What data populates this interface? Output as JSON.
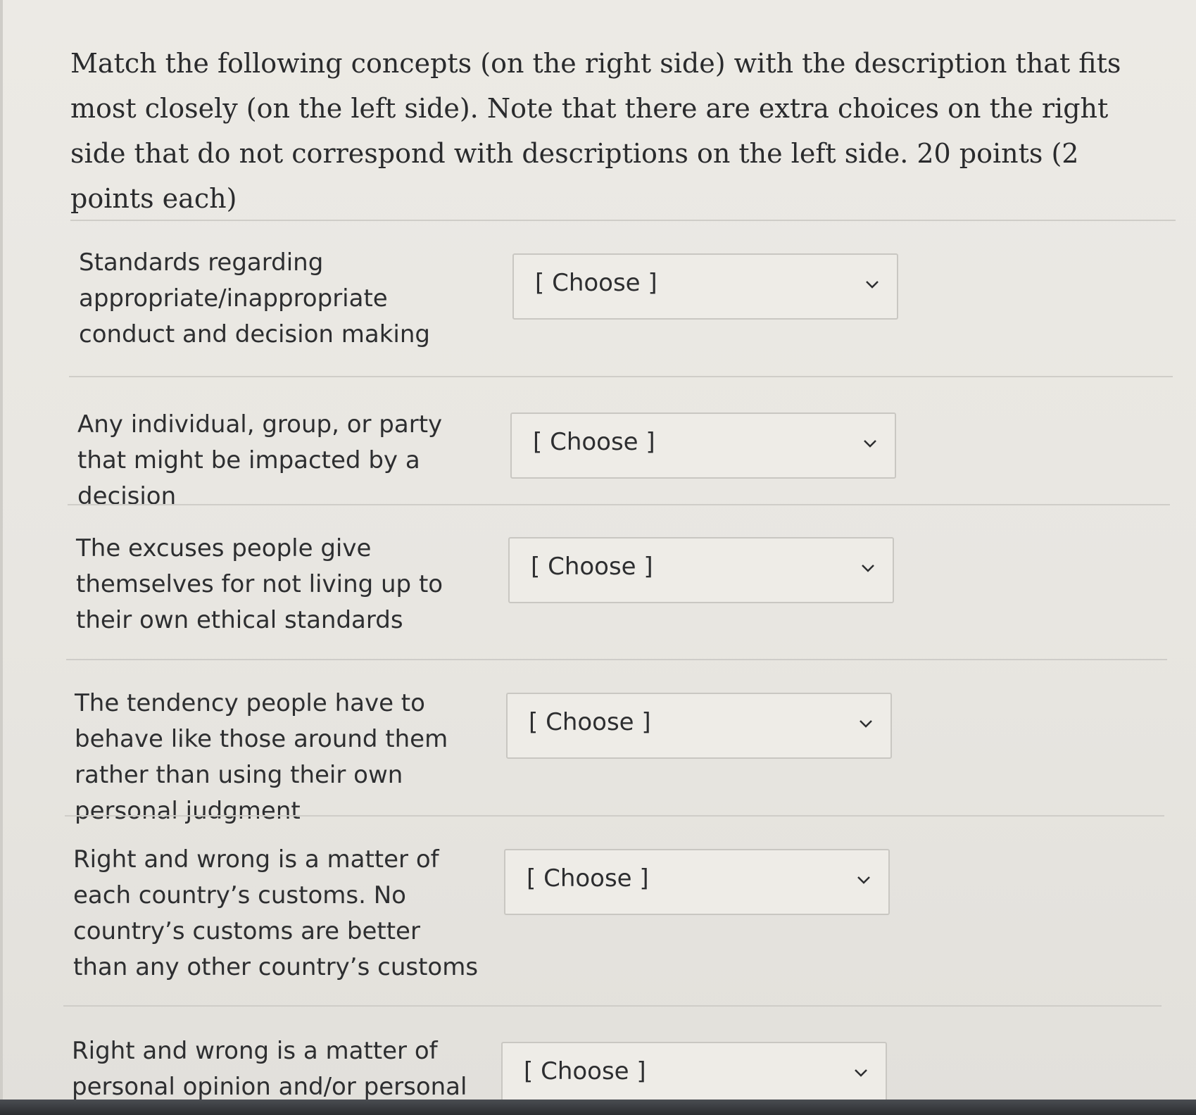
{
  "instructions": "Match the following concepts (on the right side) with the description that fits most closely (on the left side). Note that there are extra choices on the right side that do not correspond with descriptions on the left side. 20 points (2 points each)",
  "questions": [
    {
      "description": "Standards regarding appropriate/inappropriate conduct and decision making",
      "selected": "[ Choose ]"
    },
    {
      "description": "Any individual, group, or party that might be impacted by a decision",
      "selected": "[ Choose ]"
    },
    {
      "description": "The excuses people give themselves for not living up to their own ethical standards",
      "selected": "[ Choose ]"
    },
    {
      "description": "The tendency people have to behave like those around them rather than using their own personal judgment",
      "selected": "[ Choose ]"
    },
    {
      "description": "Right and wrong is a matter of each country’s customs. No country’s customs are better than any other country’s customs",
      "selected": "[ Choose ]"
    },
    {
      "description": "Right and wrong is a matter of personal opinion and/or personal",
      "selected": "[ Choose ]"
    }
  ],
  "icons": {
    "dropdown": "chevron-down-icon"
  }
}
